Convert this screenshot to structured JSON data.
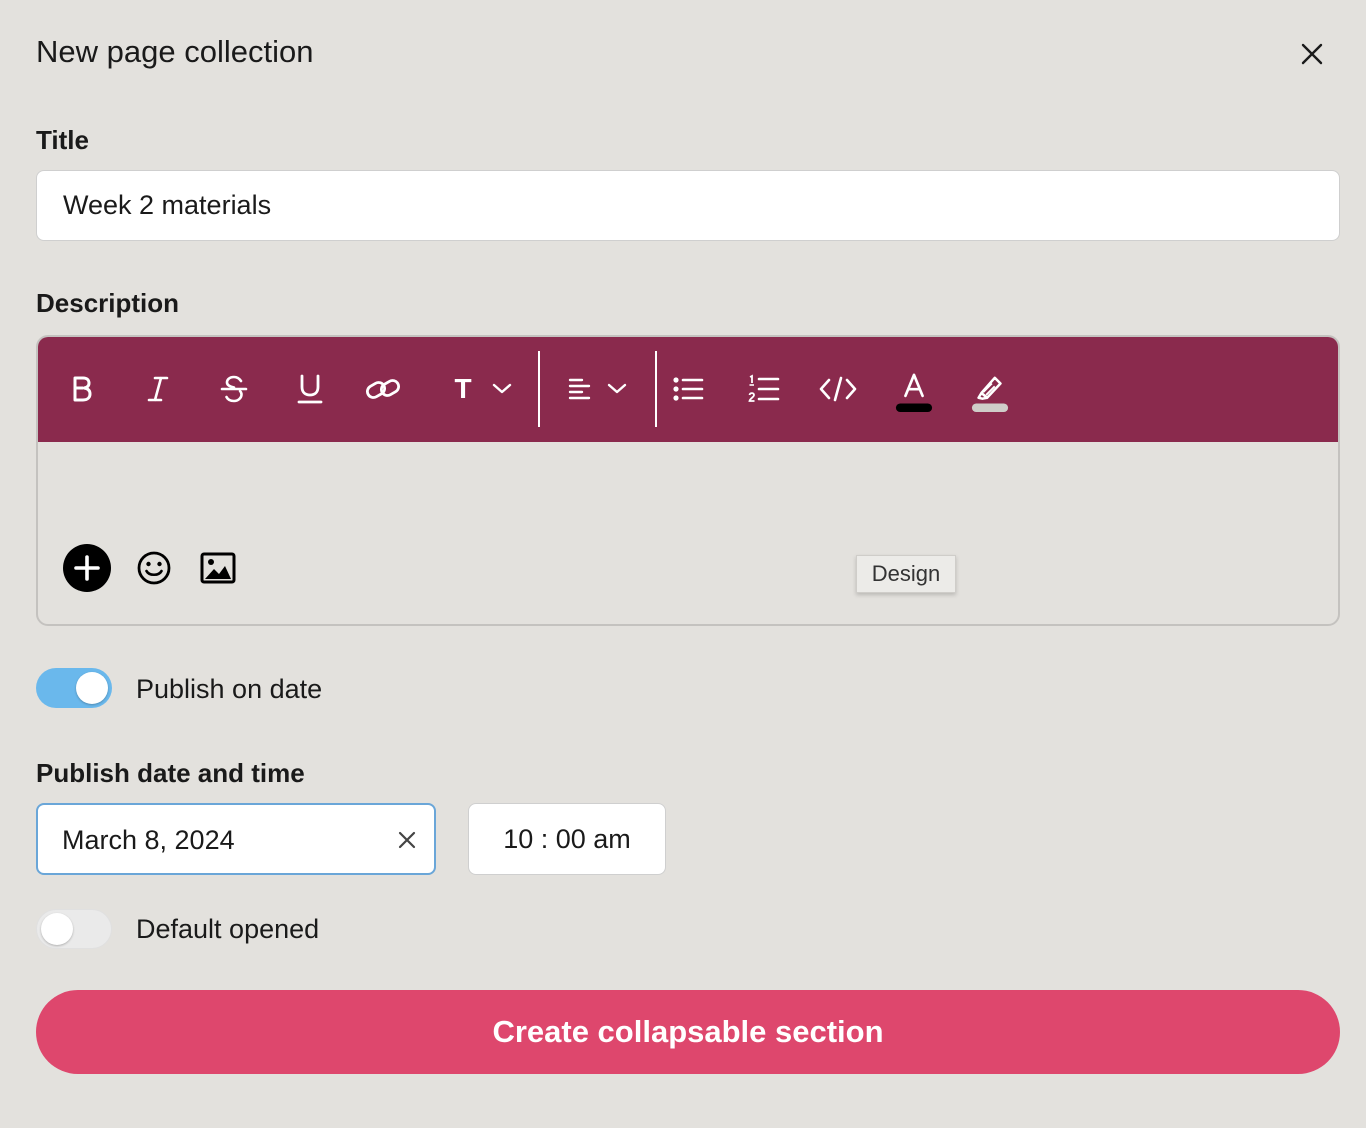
{
  "header": {
    "title": "New page collection"
  },
  "title_field": {
    "label": "Title",
    "value": "Week 2 materials"
  },
  "description": {
    "label": "Description",
    "toolbar": {
      "background": "#8a2a4d",
      "text_style_label": "T",
      "icons": [
        "bold-icon",
        "italic-icon",
        "strikethrough-icon",
        "underline-icon",
        "link-icon",
        "text-style-icon",
        "chevron-down-icon",
        "align-left-icon",
        "bulleted-list-icon",
        "numbered-list-icon",
        "code-icon",
        "text-color-icon",
        "highlight-icon"
      ]
    },
    "bottom_icons": [
      "add-icon",
      "emoji-icon",
      "image-icon"
    ],
    "tooltip": "Design"
  },
  "publish_toggle": {
    "label": "Publish on date",
    "on": true,
    "color": "#6ab8ec"
  },
  "publish_datetime": {
    "label": "Publish date and time",
    "date": "March 8, 2024",
    "time": "10 : 00 am"
  },
  "default_opened_toggle": {
    "label": "Default opened",
    "on": false
  },
  "submit": {
    "label": "Create collapsable section",
    "color": "#de476d"
  }
}
